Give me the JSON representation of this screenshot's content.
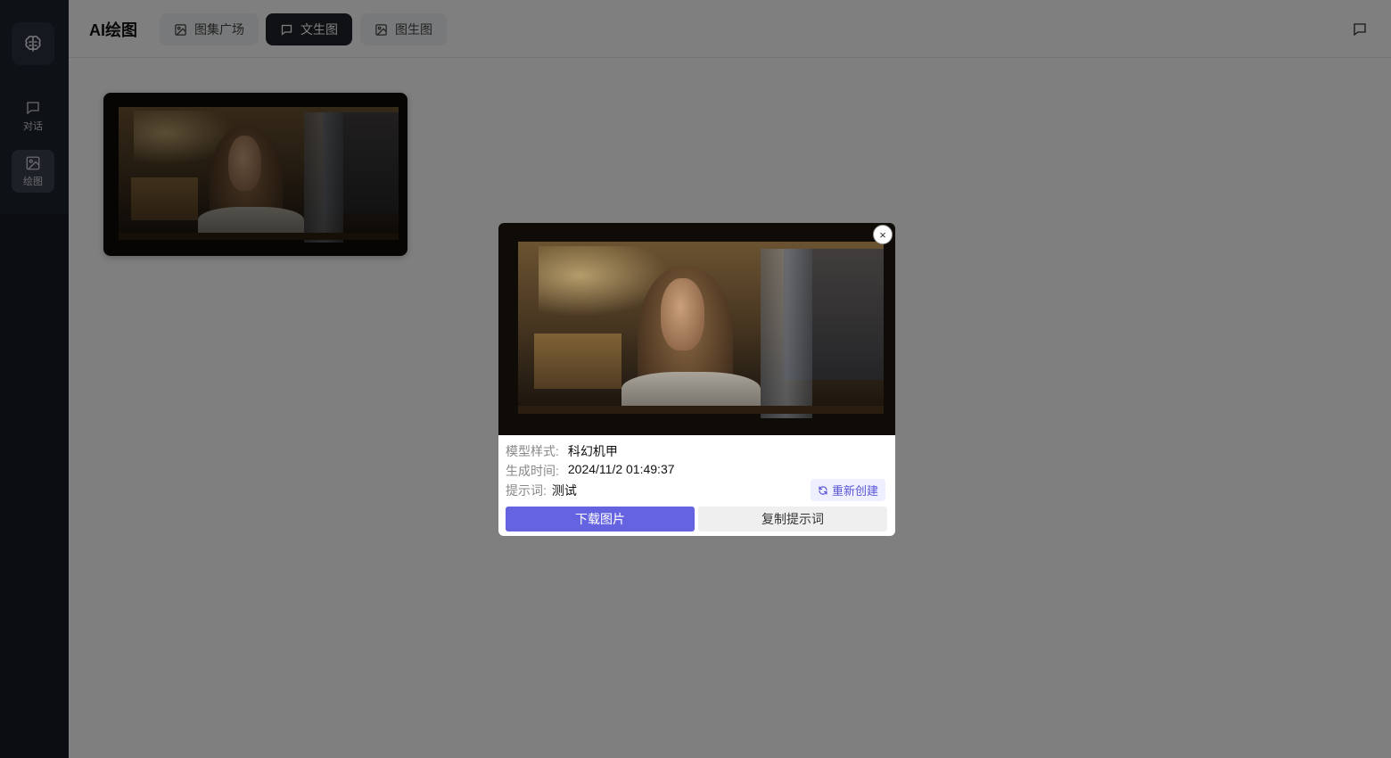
{
  "app": {
    "title": "AI绘图"
  },
  "sidebar": {
    "items": [
      {
        "label": "对话",
        "icon": "chat-icon",
        "active": false
      },
      {
        "label": "绘图",
        "icon": "image-icon",
        "active": true
      }
    ],
    "logo_icon": "brain-icon"
  },
  "header": {
    "tabs": [
      {
        "label": "图集广场",
        "icon": "image-icon",
        "active": false
      },
      {
        "label": "文生图",
        "icon": "chat-icon",
        "active": true
      },
      {
        "label": "图生图",
        "icon": "image-icon",
        "active": false
      }
    ],
    "right_icon": "chat-icon"
  },
  "modal": {
    "close_symbol": "×",
    "model_label": "模型样式:",
    "model_value": "科幻机甲",
    "time_label": "生成时间:",
    "time_value": "2024/11/2 01:49:37",
    "prompt_label": "提示词:",
    "prompt_value": "测试",
    "regenerate_label": "重新创建",
    "download_label": "下载图片",
    "copy_label": "复制提示词"
  },
  "colors": {
    "sidebar": "#161b24",
    "accent": "#6663e0",
    "active_tab": "#1f2329"
  }
}
